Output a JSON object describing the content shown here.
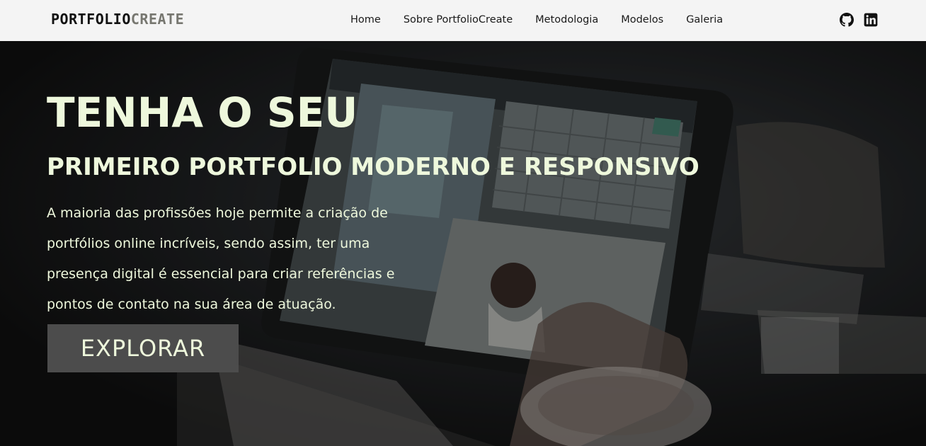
{
  "logo": {
    "part1": "PORTFOLIO",
    "part2": "CREATE"
  },
  "nav": {
    "items": [
      {
        "label": "Home"
      },
      {
        "label": "Sobre PortfolioCreate"
      },
      {
        "label": "Metodologia"
      },
      {
        "label": "Modelos"
      },
      {
        "label": "Galeria"
      }
    ],
    "social": [
      "github-icon",
      "linkedin-icon"
    ]
  },
  "hero": {
    "title_line1": "TENHA O SEU",
    "title_line2": "PRIMEIRO PORTFOLIO MODERNO E RESPONSIVO",
    "description": "A maioria das profissões hoje permite a criação de portfólios online incríveis, sendo assim, ter uma presença digital é essencial para criar referências e pontos de contato na sua área de atuação.",
    "button_label": "EXPLORAR"
  },
  "colors": {
    "nav_bg": "#f4f4f4",
    "hero_text": "#eef8dc",
    "button_bg": "#4c4c4c",
    "logo_dark": "#111111",
    "logo_grey": "#777770"
  }
}
